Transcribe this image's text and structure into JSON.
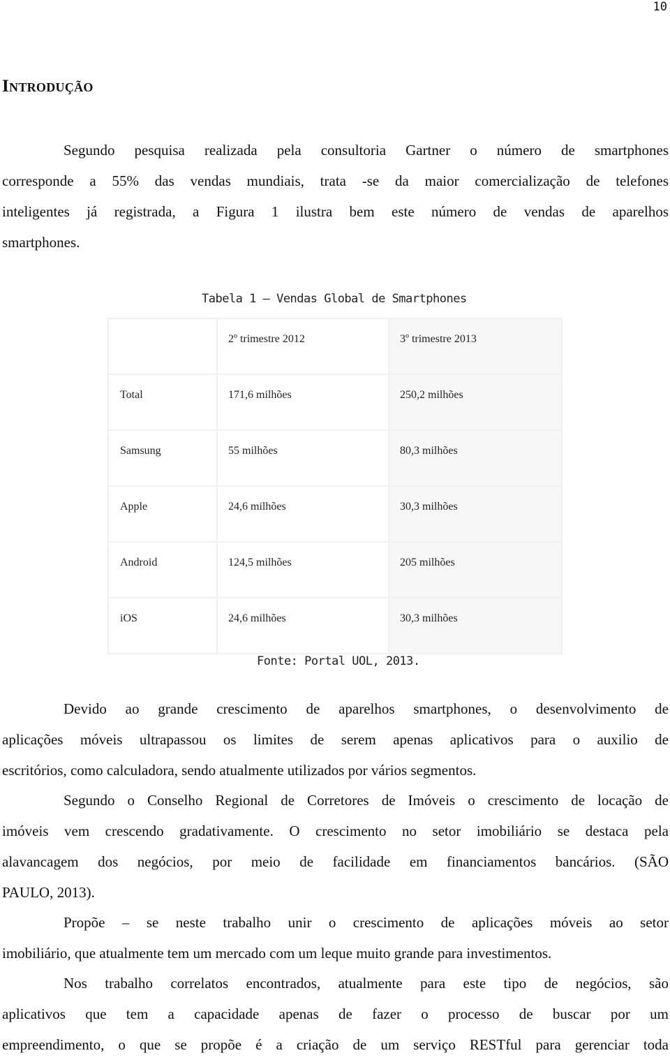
{
  "page_number": "10",
  "heading": "Introdução",
  "paragraph1": {
    "lines": [
      "Segundo pesquisa realizada pela consultoria Gartner o número de smartphones",
      "corresponde a 55% das vendas mundiais, trata -se da maior comercialização de telefones",
      "inteligentes já registrada, a Figura 1 ilustra bem este número de vendas de aparelhos",
      "smartphones."
    ]
  },
  "table": {
    "caption": "Tabela 1 – Vendas Global de Smartphones",
    "headers": [
      "",
      "2º trimestre 2012",
      "3º trimestre 2013"
    ],
    "rows": [
      [
        "Total",
        "171,6 milhões",
        "250,2 milhões"
      ],
      [
        "Samsung",
        "55 milhões",
        "80,3 milhões"
      ],
      [
        "Apple",
        "24,6 milhões",
        "30,3 milhões"
      ],
      [
        "Android",
        "124,5 milhões",
        "205 milhões"
      ],
      [
        "iOS",
        "24,6 milhões",
        "30,3 milhões"
      ]
    ],
    "source": "Fonte: Portal UOL, 2013."
  },
  "paragraph2": {
    "lines": [
      "Devido ao grande crescimento de aparelhos smartphones, o desenvolvimento de",
      "aplicações móveis ultrapassou os limites de serem apenas aplicativos para o auxilio de",
      "escritórios, como calculadora, sendo atualmente utilizados por vários segmentos."
    ]
  },
  "paragraph3": {
    "lines": [
      "Segundo o Conselho Regional de Corretores de Imóveis o crescimento de locação de",
      "imóveis vem crescendo gradativamente. O crescimento no setor imobiliário se destaca pela",
      "alavancagem dos negócios, por meio de facilidade em financiamentos bancários. (SÃO",
      "PAULO, 2013)."
    ]
  },
  "paragraph4": {
    "lines": [
      "Propõe – se neste trabalho unir o crescimento de aplicações móveis ao setor",
      "imobiliário, que atualmente tem um mercado com um leque muito grande para investimentos."
    ]
  },
  "paragraph5": {
    "lines": [
      "Nos trabalho correlatos encontrados, atualmente para este tipo de negócios, são",
      "aplicativos que tem a capacidade apenas de fazer o processo de buscar por um",
      "empreendimento, o que se propõe é a criação de um serviço RESTful para gerenciar toda"
    ]
  }
}
